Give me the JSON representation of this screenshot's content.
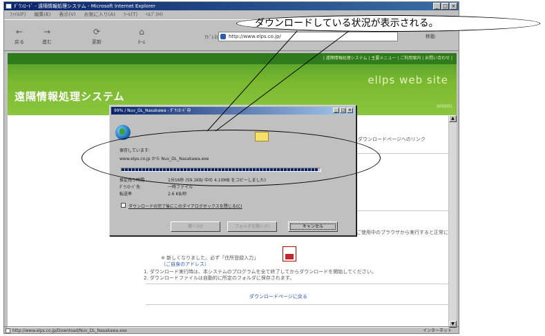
{
  "window": {
    "title": "ﾀﾞｳﾝﾛｰﾄﾞ - 遠隔情報処理システム - Microsoft Internet Explorer",
    "menu": [
      "ﾌｧｲﾙ(F)",
      "編集(E)",
      "表示(V)",
      "お気に入り(A)",
      "ﾂｰﾙ(T)",
      "ﾍﾙﾌﾟ(H)"
    ],
    "toolbar": {
      "back": "戻る",
      "forward": "進む",
      "refresh": "更新",
      "home": "ﾎｰﾑ"
    },
    "address_label": "ｱﾄﾞﾚｽ(D)",
    "address_value": "http://www.elps.co.jp/",
    "go_label": "移動"
  },
  "callout": {
    "text": "ダウンロードしている状況が表示される。"
  },
  "site": {
    "top_links": "| 遠隔情報処理システム | 主要メニュー | ご利用案内 | お問い合わせ |",
    "name": "ellps web site",
    "system_title": "遠隔情報処理システム",
    "page_code": "000001"
  },
  "page": {
    "right_link": "ダウンロードページへのリンク",
    "right_note": "ご使用中のプラウザから実行すると正常に",
    "notes": [
      "※ 新しくなりました。必ず「住所登録入力」",
      "（ご自身のアドレス）",
      "1. ダウンロード実行時は、本システムのプログラムを全て終了してからダウンロードを開始してください。",
      "2. ダウンロードファイルは自動的に所定のフォルダに保存されます。"
    ],
    "back_link": "ダウンロードページに戻る"
  },
  "status": {
    "url": "http://www.elps.co.jp/Download/Nuv_DL_Nasakawa.exe",
    "zone": "インターネット"
  },
  "dialog": {
    "title": "99% / Nuv_DL_Nasakawa - ﾀﾞｳﾝﾛｰﾄﾞ中",
    "saving_label": "保存しています:",
    "source": "www.elps.co.jp から Nuv_DL_Nasakawa.exe",
    "progress": 0.99,
    "time_left_label": "推定残り時間",
    "time_left_value": "1分16秒 (59.1KB/ 中の 4.10MB をコピーしました)",
    "dest_label": "ﾀﾞｳﾝﾛｰﾄﾞ先",
    "dest_value": "一時ファイル",
    "rate_label": "転送率",
    "rate_value": "2.6 KB/秒",
    "close_checkbox_label": "ダウンロードの完了後にこのダイアログボックスを閉じる(C)",
    "buttons": {
      "open": "開く(O)",
      "open_folder": "フォルダを開く(F)",
      "cancel": "キャンセル"
    }
  }
}
